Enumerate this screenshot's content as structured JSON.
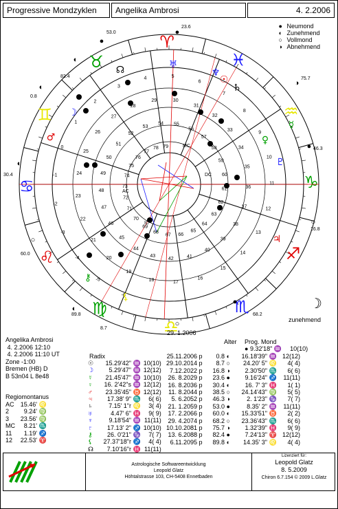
{
  "header": {
    "app_title": "Progressive Mondzyklen",
    "person": "Angelika Ambrosi",
    "date": "4. 2.2006"
  },
  "legend": [
    {
      "symbol": "●",
      "label": "Neumond"
    },
    {
      "symbol": "◐",
      "label": "Zunehmend"
    },
    {
      "symbol": "○",
      "label": "Vollmond"
    },
    {
      "symbol": "◑",
      "label": "Abnehmend"
    }
  ],
  "wheel": {
    "outer_degrees": [
      "53.0",
      "23.6",
      "75.7",
      "46.3",
      "16.8",
      "68.2",
      "38.5",
      "89.8",
      "60.0",
      "30.4",
      "0.8",
      "82.4",
      "8.7"
    ],
    "inner_ring_numbers": [
      "79",
      "78",
      "77",
      "76",
      "75",
      "74",
      "73",
      "72",
      "71",
      "70",
      "69",
      "68",
      "67",
      "66",
      "65",
      "64",
      "63",
      "62",
      "61",
      "60",
      "59",
      "58",
      "57",
      "56",
      "55",
      "54",
      "53",
      "52",
      "51",
      "50",
      "49",
      "48",
      "47",
      "46",
      "45",
      "44",
      "43",
      "42",
      "41",
      "40",
      "39",
      "38",
      "37",
      "36",
      "35",
      "34",
      "33",
      "32",
      "31",
      "30",
      "29",
      "28",
      "27",
      "26",
      "25",
      "24",
      "23",
      "22",
      "21",
      "20",
      "19",
      "18",
      "17",
      "16",
      "15",
      "14",
      "13",
      "12",
      "11",
      "10",
      "9",
      "8",
      "7",
      "6",
      "5",
      "4",
      "3",
      "2",
      "1",
      "0",
      "-1",
      "-2",
      "-3",
      "-4",
      "-5",
      "-6"
    ],
    "angle_labels": {
      "mc": "MC",
      "ac": "AC",
      "dc": "DC",
      "ic": "IC"
    },
    "phase_caption": "zunehmend"
  },
  "birth": {
    "name": "Angelika Ambrosi",
    "date_local": "4. 2.2006 12:10",
    "date_ut": "4. 2.2006 11:10 UT",
    "zone": "Zone -1:00",
    "place": "Bremen (HB) D",
    "coords": "B 53n04 L 8e48"
  },
  "regio": {
    "title": "Regiomontanus",
    "rows": [
      {
        "k": "AC",
        "v": "15.46'",
        "s": "♌"
      },
      {
        "k": "2",
        "v": "9.24'",
        "s": "♍"
      },
      {
        "k": "3",
        "v": "23.56'",
        "s": "♍"
      },
      {
        "k": "MC",
        "v": "8.21'",
        "s": "♏"
      },
      {
        "k": "11",
        "v": "1.19'",
        "s": "♐"
      },
      {
        "k": "12",
        "v": "22.53'",
        "s": "♈"
      }
    ]
  },
  "radix": {
    "title": "Radix",
    "rows": [
      {
        "p": "☉",
        "pos": "15.29'42\"",
        "s": "♒",
        "h": "10(10)",
        "c": "#000000"
      },
      {
        "p": "☽",
        "pos": "5.29'47\"",
        "s": "♒",
        "h": "12(12)",
        "c": "#1a1aff"
      },
      {
        "p": "☿",
        "pos": "21.45'47\"",
        "s": "♒",
        "h": "10(10)",
        "c": "#00a000"
      },
      {
        "p": "♀",
        "pos": "16. 2'42\"s",
        "s": "♒",
        "h": "12(12)",
        "c": "#00a000"
      },
      {
        "p": "♂",
        "pos": "23.35'45\"",
        "s": "♉",
        "h": "12(12)",
        "c": "#e00000"
      },
      {
        "p": "♃",
        "pos": "17.38' 9\"",
        "s": "♏",
        "h": "6( 6)",
        "c": "#e00000"
      },
      {
        "p": "♄",
        "pos": "7.15' 1\"r",
        "s": "♌",
        "h": "3( 4)",
        "c": "#000000"
      },
      {
        "p": "♅",
        "pos": "4.47' 6\"",
        "s": "♓",
        "h": "9( 9)",
        "c": "#1a1aff"
      },
      {
        "p": "♆",
        "pos": "9.18'54\"",
        "s": "♒",
        "h": "11(11)",
        "c": "#1a1aff"
      },
      {
        "p": "♇",
        "pos": "17.13' 2\"",
        "s": "♐",
        "h": "10(10)",
        "c": "#1a1aff"
      },
      {
        "p": "⚷",
        "pos": "26. 0'21\"",
        "s": "♑",
        "h": "7( 7)",
        "c": "#00a000"
      },
      {
        "p": "⚸",
        "pos": "27.37'18\"r",
        "s": "♐",
        "h": "4( 4)",
        "c": "#00a000"
      },
      {
        "p": "☊",
        "pos": "7.10'16\"r",
        "s": "♓",
        "h": "11(11)",
        "c": "#000000"
      }
    ]
  },
  "dates": {
    "header_age": "Alter",
    "header_prog": "Prog. Mond",
    "first_date": "29. 1.2006",
    "first_prog": "9.32'18\"",
    "first_prog_sign": "♒",
    "first_house": "10(10)",
    "rows": [
      {
        "d": "25.11.2006",
        "t": "p",
        "a": "0.8",
        "ph": "◐",
        "pm": "16.18'39\"",
        "ps": "♒",
        "h": "12(12)"
      },
      {
        "d": "29.10.2014",
        "t": "p",
        "a": "8.7",
        "ph": "○",
        "pm": "24.20' 5\"",
        "ps": "♌",
        "h": "4( 4)"
      },
      {
        "d": "7.12.2022",
        "t": "p",
        "a": "16.8",
        "ph": "◑",
        "pm": "2.30'50\"",
        "ps": "♏",
        "h": "6( 6)"
      },
      {
        "d": "26. 8.2029",
        "t": "p",
        "a": "23.6",
        "ph": "●",
        "pm": "9.16'24\"",
        "ps": "♐",
        "h": "11(11)"
      },
      {
        "d": "16. 8.2036",
        "t": "p",
        "a": "30.4",
        "ph": "◐",
        "pm": "16. 7' 3\"",
        "ps": "♓",
        "h": "1( 1)"
      },
      {
        "d": "11. 8.2044",
        "t": "p",
        "a": "38.5",
        "ph": "○",
        "pm": "24.14'43\"",
        "ps": "♍",
        "h": "5( 5)"
      },
      {
        "d": "5. 6.2052",
        "t": "p",
        "a": "46.3",
        "ph": "◑",
        "pm": "2. 1'23\"",
        "ps": "♑",
        "h": "7( 7)"
      },
      {
        "d": "21. 1.2059",
        "t": "p",
        "a": "53.0",
        "ph": "●",
        "pm": "8.35' 2\"",
        "ps": "♒",
        "h": "11(11)"
      },
      {
        "d": "17. 2.2066",
        "t": "p",
        "a": "60.0",
        "ph": "◐",
        "pm": "15.33'51\"",
        "ps": "♉",
        "h": "2( 2)"
      },
      {
        "d": "29. 4.2074",
        "t": "p",
        "a": "68.2",
        "ph": "○",
        "pm": "23.36'43\"",
        "ps": "♏",
        "h": "6( 6)"
      },
      {
        "d": "10.10.2081",
        "t": "p",
        "a": "75.7",
        "ph": "◑",
        "pm": "1.32'39\"",
        "ps": "♓",
        "h": "9( 9)"
      },
      {
        "d": "13. 6.2088",
        "t": "p",
        "a": "82.4",
        "ph": "●",
        "pm": "7.24'13\"",
        "ps": "♈",
        "h": "12(12)"
      },
      {
        "d": "6.11.2095",
        "t": "p",
        "a": "89.8",
        "ph": "◐",
        "pm": "14.35' 3\"",
        "ps": "♌",
        "h": "4( 4)"
      }
    ]
  },
  "footer": {
    "company": "Astrologische Softwareentwicklung",
    "owner": "Leopold Glatz",
    "address": "Höhtalstrasse 103, CH-5408 Ennetbaden",
    "license_label": "Lizenziert für:",
    "licensee": "Leopold Glatz",
    "license_date": "8. 5.2009",
    "version": "Chiron 6.7.154 © 2009 L.Glatz"
  }
}
